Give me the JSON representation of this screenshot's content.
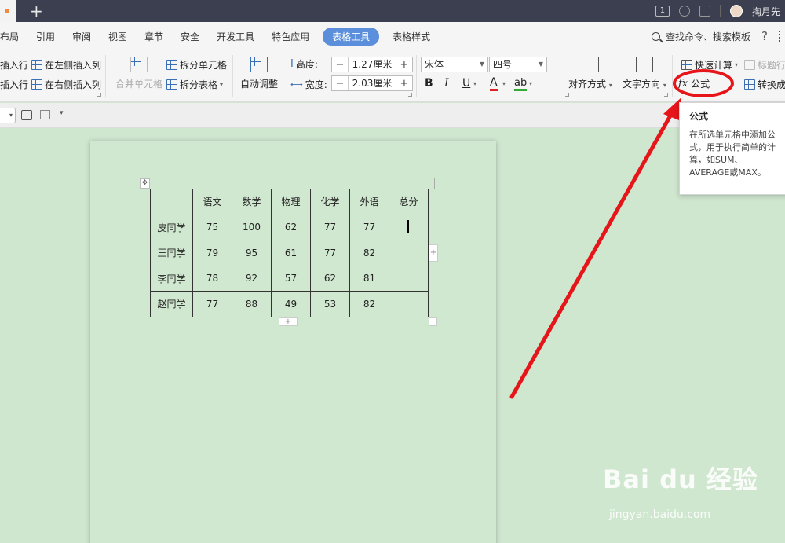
{
  "titlebar": {
    "new_tab": "+",
    "badge": "1",
    "user_name": "掏月先"
  },
  "menu": {
    "items": [
      "布局",
      "引用",
      "审阅",
      "视图",
      "章节",
      "安全",
      "开发工具",
      "特色应用",
      "表格工具",
      "表格样式"
    ],
    "active_index": 8,
    "search": "查找命令、搜索模板",
    "help": "?"
  },
  "ribbon": {
    "insert_row_above": "插入行",
    "insert_row_below": "插入行",
    "insert_col_left": "在左侧插入列",
    "insert_col_right": "在右侧插入列",
    "merge_cells": "合并单元格",
    "split_cells": "拆分单元格",
    "split_table": "拆分表格",
    "auto_adjust": "自动调整",
    "height_label": "高度:",
    "height_value": "1.27厘米",
    "width_label": "宽度:",
    "width_value": "2.03厘米",
    "font_name": "宋体",
    "font_size": "四号",
    "bold": "B",
    "italic": "I",
    "underline": "U",
    "font_color": "A",
    "highlight": "ab",
    "align": "对齐方式",
    "text_direction": "文字方向",
    "quick_calc": "快速计算",
    "title_row": "标题行",
    "formula": "公式",
    "convert": "转换成",
    "minus": "−",
    "plus": "+"
  },
  "table": {
    "header": [
      "",
      "语文",
      "数学",
      "物理",
      "化学",
      "外语",
      "总分"
    ],
    "rows": [
      [
        "皮同学",
        "75",
        "100",
        "62",
        "77",
        "77",
        ""
      ],
      [
        "王同学",
        "79",
        "95",
        "61",
        "77",
        "82",
        ""
      ],
      [
        "李同学",
        "78",
        "92",
        "57",
        "62",
        "81",
        ""
      ],
      [
        "赵同学",
        "77",
        "88",
        "49",
        "53",
        "82",
        ""
      ]
    ]
  },
  "tooltip": {
    "title": "公式",
    "body": "在所选单元格中添加公式，用于执行简单的计算，如SUM、AVERAGE或MAX。"
  },
  "watermark": {
    "logo": "Bai du 经验",
    "url": "jingyan.baidu.com"
  },
  "colors": {
    "accent": "#5b8fdb",
    "annotation_red": "#e6151a",
    "page_bg": "#cfe6cf"
  }
}
